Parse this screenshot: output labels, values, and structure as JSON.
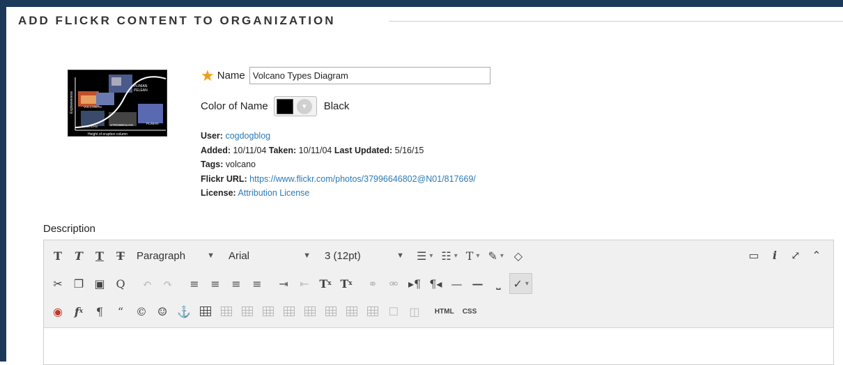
{
  "header": {
    "title": "ADD FLICKR CONTENT TO ORGANIZATION"
  },
  "thumbnail": {
    "labels": [
      "PLINIAN",
      "PELEAN",
      "VULCANIAN",
      "PLINIAN",
      "STROMBOLIAN",
      "HAWAIIAN"
    ],
    "y_label": "Explosiveness",
    "x_label": "Height of eruption column"
  },
  "form": {
    "name_label": "Name",
    "name_value": "Volcano Types Diagram",
    "color_label": "Color of Name",
    "color_swatch": "#000000",
    "color_value": "Black"
  },
  "meta": {
    "user_label": "User:",
    "user_value": "cogdogblog",
    "added_label": "Added:",
    "added_value": "10/11/04",
    "taken_label": "Taken:",
    "taken_value": "10/11/04",
    "updated_label": "Last Updated:",
    "updated_value": "5/16/15",
    "tags_label": "Tags:",
    "tags_value": "volcano",
    "url_label": "Flickr URL:",
    "url_value": "https://www.flickr.com/photos/37996646802@N01/817669/",
    "license_label": "License:",
    "license_value": "Attribution License"
  },
  "description": {
    "label": "Description",
    "format_select": "Paragraph",
    "font_select": "Arial",
    "size_select": "3 (12pt)",
    "html_label": "HTML",
    "css_label": "CSS"
  }
}
